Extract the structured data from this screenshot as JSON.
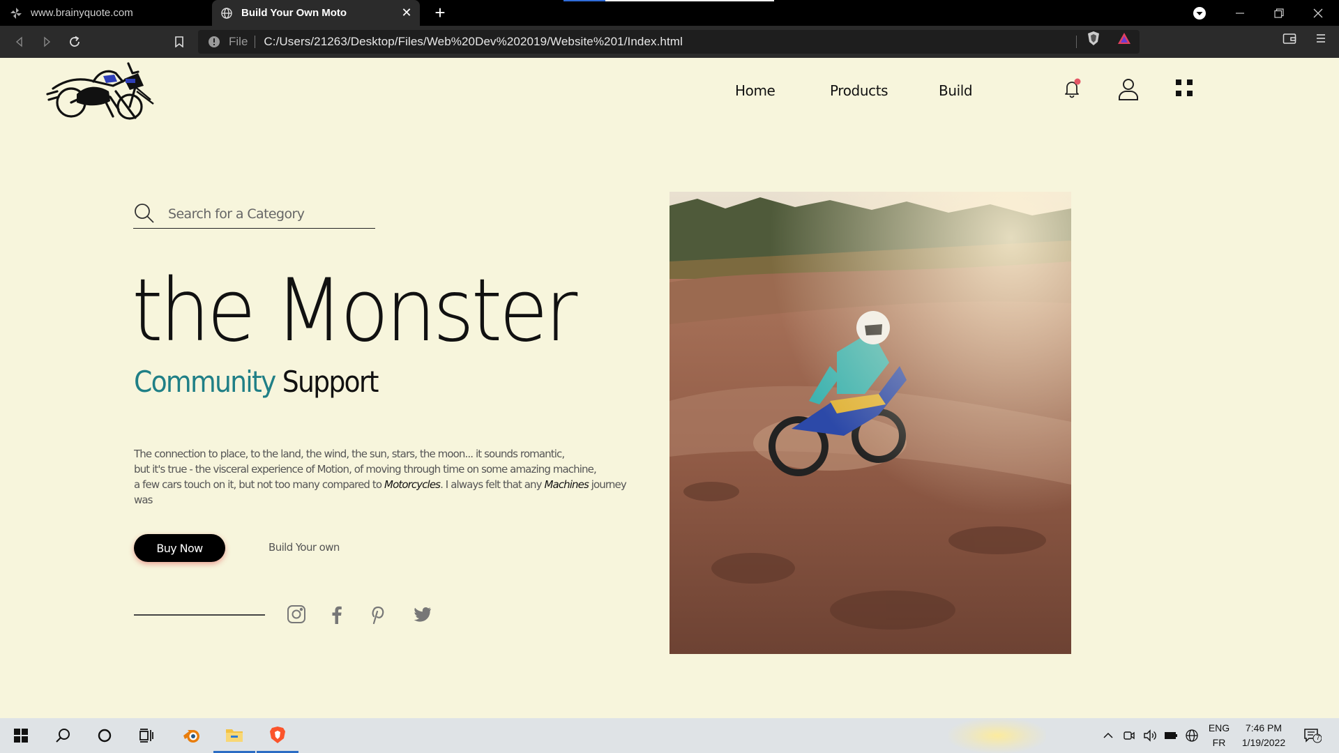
{
  "browser": {
    "tabs": [
      {
        "title": "www.brainyquote.com",
        "active": false
      },
      {
        "title": "Build Your Own Moto",
        "active": true
      }
    ],
    "url_scheme": "File",
    "url": "C:/Users/21263/Desktop/Files/Web%20Dev%202019/Website%201/Index.html"
  },
  "nav": {
    "links": [
      "Home",
      "Products",
      "Build"
    ],
    "icons": [
      "bell-icon",
      "user-icon",
      "grid-menu-icon"
    ]
  },
  "hero": {
    "search_placeholder": "Search for a Category",
    "headline": "the Monster",
    "subhead_accent": "Community",
    "subhead_plain": "Support",
    "body_line1": "The connection to place, to the land, the wind, the sun, stars, the moon... it sounds romantic,",
    "body_line2": "but it's true - the visceral experience of Motion, of moving through time on some amazing machine,",
    "body_line3_a": "a few cars touch on it, but not too many compared to",
    "body_line3_em1": "Motorcycles",
    "body_line3_b": ". I always felt that any",
    "body_line3_em2": "Machines",
    "body_line3_c": "journey was",
    "buy_label": "Buy Now",
    "build_label": "Build Your own",
    "social": [
      "instagram-icon",
      "facebook-icon",
      "pinterest-icon",
      "twitter-icon"
    ]
  },
  "taskbar": {
    "lang_top": "ENG",
    "lang_bottom": "FR",
    "time": "7:46 PM",
    "date": "1/19/2022",
    "notifications": "7"
  },
  "colors": {
    "page_bg": "#f7f5dc",
    "accent": "#1f7f86",
    "button_bg": "#000000"
  }
}
